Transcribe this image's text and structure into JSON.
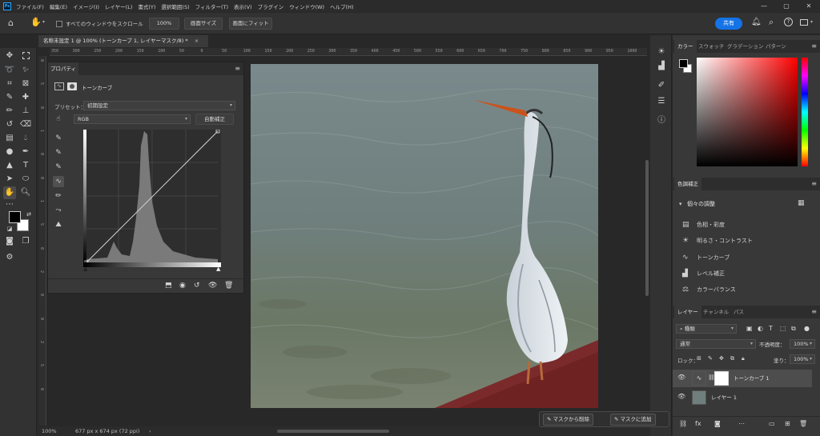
{
  "app": {
    "logo_text": "Ps"
  },
  "menubar": {
    "items": [
      "ファイル(F)",
      "編集(E)",
      "イメージ(I)",
      "レイヤー(L)",
      "書式(Y)",
      "選択範囲(S)",
      "フィルター(T)",
      "表示(V)",
      "プラグイン",
      "ウィンドウ(W)",
      "ヘルプ(H)"
    ],
    "window_controls": [
      "—",
      "▢",
      "✕"
    ]
  },
  "optionsbar": {
    "scroll_all_label": "すべてのウィンドウをスクロール",
    "zoom_value": "100%",
    "fit_screen_label": "画面サイズ",
    "fill_screen_label": "画面にフィット",
    "share_label": "共有"
  },
  "document": {
    "tab_title": "名称未設定 1 @ 100% (トーンカーブ 1, レイヤーマスク/8) *",
    "tab_close": "×"
  },
  "rulers": {
    "h_ticks": [
      "350",
      "300",
      "250",
      "200",
      "150",
      "100",
      "50",
      "0",
      "50",
      "100",
      "150",
      "200",
      "250",
      "300",
      "350",
      "400",
      "450",
      "500",
      "550",
      "600",
      "650",
      "700",
      "750",
      "800",
      "850",
      "900",
      "950",
      "1000"
    ],
    "v_ticks": [
      "0",
      "5",
      "0",
      "1",
      "0",
      "0",
      "1",
      "5",
      "0",
      "2",
      "0",
      "0",
      "2",
      "5",
      "0"
    ]
  },
  "properties": {
    "tab_label": "プロパティ",
    "adjustment_name": "トーンカーブ",
    "preset_label": "プリセット：",
    "preset_value": "初期設定",
    "channel_value": "RGB",
    "auto_label": "自動補正"
  },
  "color_panel": {
    "tabs": [
      "カラー",
      "スウォッチ",
      "グラデーション",
      "パターン"
    ]
  },
  "adjustments_panel": {
    "tab_label": "色調補正",
    "section_label": "個々の調整",
    "items": [
      {
        "label": "色相・彩度",
        "icon": "hue-saturation-icon"
      },
      {
        "label": "明るさ・コントラスト",
        "icon": "brightness-contrast-icon"
      },
      {
        "label": "トーンカーブ",
        "icon": "curves-icon"
      },
      {
        "label": "レベル補正",
        "icon": "levels-icon"
      },
      {
        "label": "カラーバランス",
        "icon": "color-balance-icon"
      }
    ]
  },
  "layers_panel": {
    "tabs": [
      "レイヤー",
      "チャンネル",
      "パス"
    ],
    "filter_value": "種類",
    "blend_mode": "通常",
    "opacity_label": "不透明度：",
    "opacity_value": "100%",
    "lock_label": "ロック：",
    "fill_label": "塗り：",
    "fill_value": "100%",
    "layers": [
      {
        "name": "トーンカーブ 1",
        "selected": true
      },
      {
        "name": "レイヤー 1",
        "selected": false
      }
    ]
  },
  "statusbar": {
    "zoom": "100%",
    "doc_info": "677 px x 674 px (72 ppi)"
  },
  "context_bar": {
    "subtract_label": "マスクから削除",
    "add_label": "マスクに追加"
  },
  "colors": {
    "accent": "#1473e6",
    "foreground": "#000000",
    "background": "#ffffff"
  }
}
